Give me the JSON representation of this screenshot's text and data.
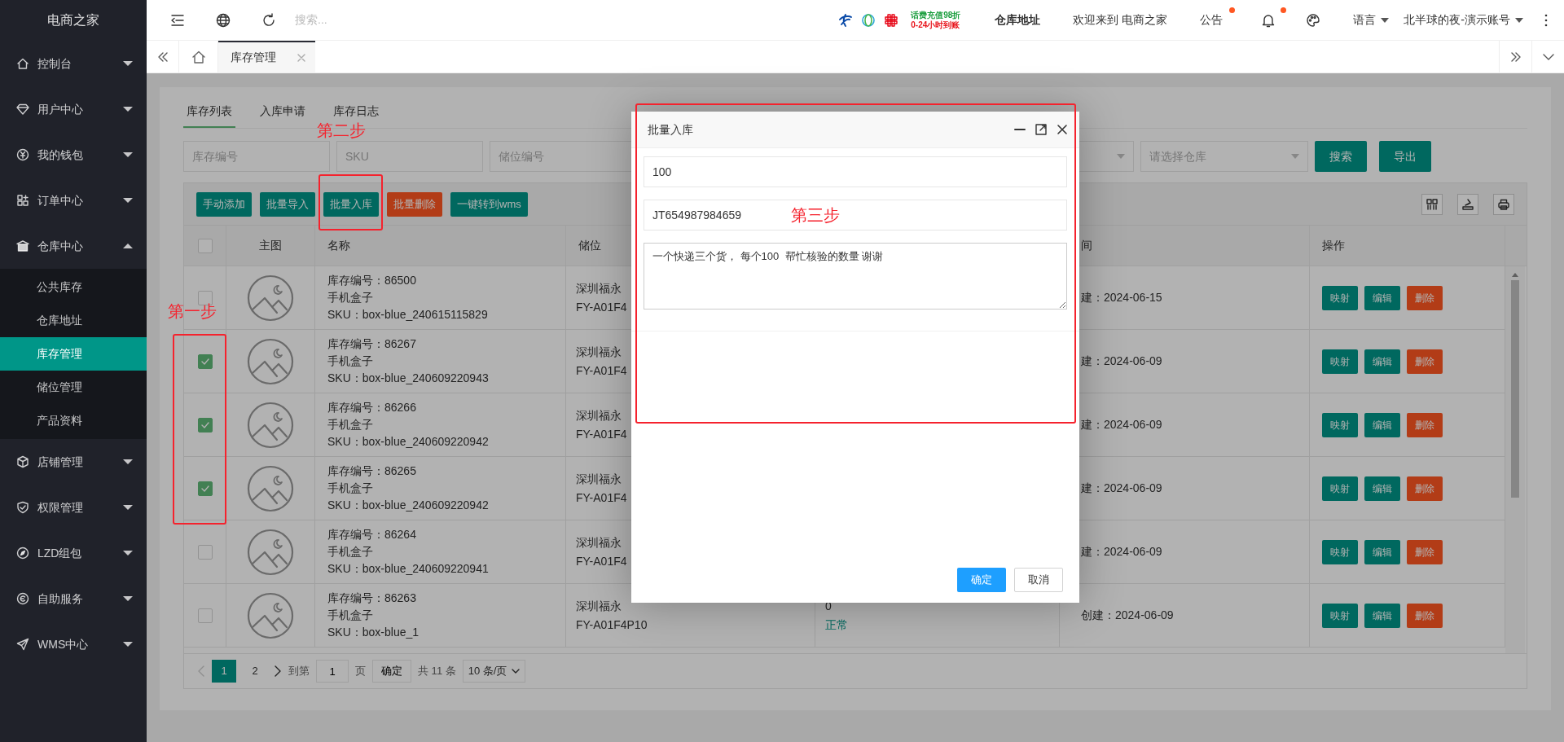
{
  "sidebar": {
    "logo": "电商之家",
    "items": [
      {
        "label": "控制台",
        "expanded": false
      },
      {
        "label": "用户中心",
        "expanded": false
      },
      {
        "label": "我的钱包",
        "expanded": false
      },
      {
        "label": "订单中心",
        "expanded": false
      },
      {
        "label": "仓库中心",
        "expanded": true,
        "children": [
          {
            "label": "公共库存",
            "selected": false
          },
          {
            "label": "仓库地址",
            "selected": false
          },
          {
            "label": "库存管理",
            "selected": true
          },
          {
            "label": "储位管理",
            "selected": false
          },
          {
            "label": "产品资料",
            "selected": false
          }
        ]
      },
      {
        "label": "店铺管理",
        "expanded": false
      },
      {
        "label": "权限管理",
        "expanded": false
      },
      {
        "label": "LZD组包",
        "expanded": false
      },
      {
        "label": "自助服务",
        "expanded": false
      },
      {
        "label": "WMS中心",
        "expanded": false
      }
    ]
  },
  "topbar": {
    "search": {
      "placeholder": "搜索..."
    },
    "promo": [
      "话费充值98折",
      "0-24小时到账"
    ],
    "warehouse_link": "仓库地址",
    "welcome": "欢迎来到 电商之家",
    "notice": {
      "label": "公告",
      "unread": true
    },
    "bell": {
      "unread": true
    },
    "language": "语言",
    "account": "北半球的夜-演示账号"
  },
  "page_tabs": [
    {
      "label": "库存管理",
      "selected": true
    }
  ],
  "content": {
    "tabs": [
      {
        "label": "库存列表",
        "selected": true
      },
      {
        "label": "入库申请",
        "selected": false
      },
      {
        "label": "库存日志",
        "selected": false
      }
    ],
    "filters": [
      {
        "kind": "input",
        "placeholder": "库存编号"
      },
      {
        "kind": "input",
        "placeholder": "SKU"
      },
      {
        "kind": "input",
        "placeholder": "储位编号"
      },
      {
        "kind": "select"
      },
      {
        "kind": "select",
        "placeholder": "请选择仓库"
      }
    ],
    "filter_buttons": [
      "搜索",
      "导出"
    ],
    "toolbar": [
      {
        "label": "手动添加",
        "kind": "primary"
      },
      {
        "label": "批量导入",
        "kind": "primary"
      },
      {
        "label": "批量入库",
        "kind": "primary"
      },
      {
        "label": "批量删除",
        "kind": "danger"
      },
      {
        "label": "一键转到wms",
        "kind": "primary"
      }
    ],
    "table": {
      "all_checked": false,
      "columns": {
        "image": "主图",
        "name": "名称",
        "location": "储位",
        "column_6": "间",
        "actions": "操作"
      },
      "rows": [
        {
          "checked": false,
          "stock_no": "库存编号：86500",
          "name": "手机盒子",
          "sku": "SKU：box-blue_240615115829",
          "location": [
            "深圳福永",
            "FY-A01F4"
          ],
          "time": "建：2024-06-15",
          "actions": [
            {
              "label": "映射",
              "kind": "primary"
            },
            {
              "label": "编辑",
              "kind": "primary"
            },
            {
              "label": "删除",
              "kind": "danger"
            }
          ]
        },
        {
          "checked": true,
          "stock_no": "库存编号：86267",
          "name": "手机盒子",
          "sku": "SKU：box-blue_240609220943",
          "location": [
            "深圳福永",
            "FY-A01F4"
          ],
          "time": "建：2024-06-09",
          "actions": [
            {
              "label": "映射",
              "kind": "primary"
            },
            {
              "label": "编辑",
              "kind": "primary"
            },
            {
              "label": "删除",
              "kind": "danger"
            }
          ]
        },
        {
          "checked": true,
          "stock_no": "库存编号：86266",
          "name": "手机盒子",
          "sku": "SKU：box-blue_240609220942",
          "location": [
            "深圳福永",
            "FY-A01F4"
          ],
          "time": "建：2024-06-09",
          "actions": [
            {
              "label": "映射",
              "kind": "primary"
            },
            {
              "label": "编辑",
              "kind": "primary"
            },
            {
              "label": "删除",
              "kind": "danger"
            }
          ]
        },
        {
          "checked": true,
          "stock_no": "库存编号：86265",
          "name": "手机盒子",
          "sku": "SKU：box-blue_240609220942",
          "location": [
            "深圳福永",
            "FY-A01F4"
          ],
          "time": "建：2024-06-09",
          "actions": [
            {
              "label": "映射",
              "kind": "primary"
            },
            {
              "label": "编辑",
              "kind": "primary"
            },
            {
              "label": "删除",
              "kind": "danger"
            }
          ]
        },
        {
          "checked": false,
          "stock_no": "库存编号：86264",
          "name": "手机盒子",
          "sku": "SKU：box-blue_240609220941",
          "location": [
            "深圳福永",
            "FY-A01F4"
          ],
          "time": "建：2024-06-09",
          "actions": [
            {
              "label": "映射",
              "kind": "primary"
            },
            {
              "label": "编辑",
              "kind": "primary"
            },
            {
              "label": "删除",
              "kind": "danger"
            }
          ]
        },
        {
          "checked": false,
          "stock_no": "库存编号：86263",
          "name": "手机盒子",
          "sku": "SKU：box-blue_1",
          "location": [
            "深圳福永",
            "FY-A01F4P10"
          ],
          "column_5": {
            "value": "0",
            "status": "正常"
          },
          "time": "创建：2024-06-09",
          "actions": [
            {
              "label": "映射",
              "kind": "primary"
            },
            {
              "label": "编辑",
              "kind": "primary"
            },
            {
              "label": "删除",
              "kind": "danger"
            }
          ]
        }
      ]
    },
    "pagination": {
      "prev_disabled": true,
      "pages": [
        {
          "label": "1",
          "selected": true
        },
        {
          "label": "2",
          "selected": false
        }
      ],
      "goto_label": "到第",
      "goto_value": "1",
      "page_unit": "页",
      "confirm": "确定",
      "total": "共 11 条",
      "page_size": "10 条/页"
    }
  },
  "dialog": {
    "title": "批量入库",
    "fields": [
      {
        "kind": "input",
        "value": "100"
      },
      {
        "kind": "input",
        "value": "JT654987984659"
      },
      {
        "kind": "textarea",
        "value": "一个快递三个货， 每个100  帮忙核验的数量 谢谢"
      }
    ],
    "buttons": [
      {
        "label": "确定",
        "kind": "primary"
      },
      {
        "label": "取消",
        "kind": "default"
      }
    ]
  },
  "annotations": [
    "第一步",
    "第二步",
    "第三步"
  ]
}
